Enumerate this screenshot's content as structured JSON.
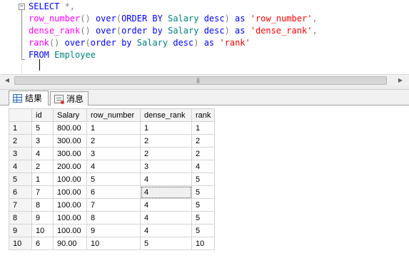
{
  "editor": {
    "collapse_symbol": "−",
    "lines": [
      [
        {
          "c": "kw",
          "t": "SELECT "
        },
        {
          "c": "gr",
          "t": "*,"
        }
      ],
      [
        {
          "c": "fn",
          "t": "row_number"
        },
        {
          "c": "gr",
          "t": "() "
        },
        {
          "c": "kw",
          "t": "over"
        },
        {
          "c": "gr",
          "t": "("
        },
        {
          "c": "kw",
          "t": "ORDER BY "
        },
        {
          "c": "tx",
          "t": "Salary "
        },
        {
          "c": "kw",
          "t": "desc"
        },
        {
          "c": "gr",
          "t": ") "
        },
        {
          "c": "kw",
          "t": "as "
        },
        {
          "c": "str",
          "t": "'row_number'"
        },
        {
          "c": "gr",
          "t": ","
        }
      ],
      [
        {
          "c": "fn",
          "t": "dense_rank"
        },
        {
          "c": "gr",
          "t": "() "
        },
        {
          "c": "kw",
          "t": "over"
        },
        {
          "c": "gr",
          "t": "("
        },
        {
          "c": "kw",
          "t": "order by "
        },
        {
          "c": "tx",
          "t": "Salary "
        },
        {
          "c": "kw",
          "t": "desc"
        },
        {
          "c": "gr",
          "t": ") "
        },
        {
          "c": "kw",
          "t": "as "
        },
        {
          "c": "str",
          "t": "'dense_rank'"
        },
        {
          "c": "gr",
          "t": ","
        }
      ],
      [
        {
          "c": "fn",
          "t": "rank"
        },
        {
          "c": "gr",
          "t": "() "
        },
        {
          "c": "kw",
          "t": "over"
        },
        {
          "c": "gr",
          "t": "("
        },
        {
          "c": "kw",
          "t": "order by "
        },
        {
          "c": "tx",
          "t": "Salary "
        },
        {
          "c": "kw",
          "t": "desc"
        },
        {
          "c": "gr",
          "t": ") "
        },
        {
          "c": "kw",
          "t": "as "
        },
        {
          "c": "str",
          "t": "'rank'"
        }
      ],
      [
        {
          "c": "kw",
          "t": "FROM "
        },
        {
          "c": "tx",
          "t": "Employee"
        }
      ]
    ]
  },
  "scrollbar": {
    "left_arrow": "◀",
    "right_arrow": "▶",
    "grip": "|||"
  },
  "tabs": {
    "results_label": "结果",
    "messages_label": "消息"
  },
  "results": {
    "columns": [
      "id",
      "Salary",
      "row_number",
      "dense_rank",
      "rank"
    ],
    "rows": [
      {
        "n": "1",
        "cells": [
          "5",
          "800.00",
          "1",
          "1",
          "1"
        ]
      },
      {
        "n": "2",
        "cells": [
          "3",
          "300.00",
          "2",
          "2",
          "2"
        ]
      },
      {
        "n": "3",
        "cells": [
          "4",
          "300.00",
          "3",
          "2",
          "2"
        ]
      },
      {
        "n": "4",
        "cells": [
          "2",
          "200.00",
          "4",
          "3",
          "4"
        ]
      },
      {
        "n": "5",
        "cells": [
          "1",
          "100.00",
          "5",
          "4",
          "5"
        ]
      },
      {
        "n": "6",
        "cells": [
          "7",
          "100.00",
          "6",
          "4",
          "5"
        ]
      },
      {
        "n": "7",
        "cells": [
          "8",
          "100.00",
          "7",
          "4",
          "5"
        ]
      },
      {
        "n": "8",
        "cells": [
          "9",
          "100.00",
          "8",
          "4",
          "5"
        ]
      },
      {
        "n": "9",
        "cells": [
          "10",
          "100.00",
          "9",
          "4",
          "5"
        ]
      },
      {
        "n": "10",
        "cells": [
          "6",
          "90.00",
          "10",
          "5",
          "10"
        ]
      }
    ],
    "selected_cell": {
      "row": 5,
      "col": 3
    }
  },
  "colors": {
    "keyword": "#0000ff",
    "function": "#ff00ff",
    "string": "#ff0000",
    "identifier": "#008080",
    "punctuation": "#808080"
  }
}
